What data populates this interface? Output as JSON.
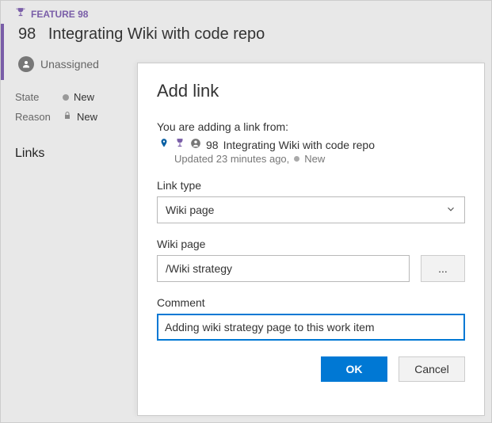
{
  "work_item": {
    "type_label": "FEATURE 98",
    "id": "98",
    "title": "Integrating Wiki with code repo",
    "assignee": "Unassigned",
    "state_label": "State",
    "state_value": "New",
    "reason_label": "Reason",
    "reason_value": "New",
    "links_heading": "Links"
  },
  "dialog": {
    "title": "Add link",
    "context_label": "You are adding a link from:",
    "context_item_id": "98",
    "context_item_title": "Integrating Wiki with code repo",
    "context_updated": "Updated 23 minutes ago,",
    "context_state": "New",
    "link_type_label": "Link type",
    "link_type_value": "Wiki page",
    "wiki_page_label": "Wiki page",
    "wiki_page_value": "/Wiki strategy",
    "browse_label": "...",
    "comment_label": "Comment",
    "comment_value": "Adding wiki strategy page to this work item",
    "ok_label": "OK",
    "cancel_label": "Cancel"
  },
  "colors": {
    "feature_purple": "#7a5ea8",
    "primary_blue": "#0078d4"
  }
}
